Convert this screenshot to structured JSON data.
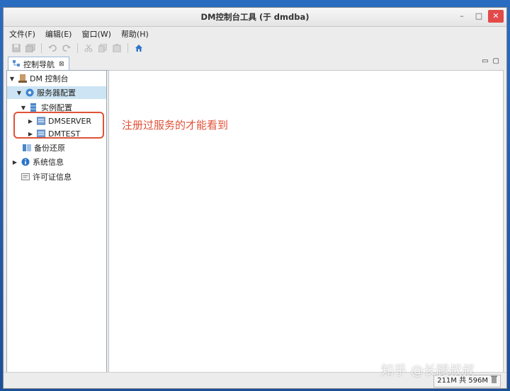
{
  "window": {
    "title": "DM控制台工具 (于 dmdba)"
  },
  "window_controls": {
    "minimize": "–",
    "maximize": "□",
    "close": "✕"
  },
  "menu": [
    "文件(F)",
    "编辑(E)",
    "窗口(W)",
    "帮助(H)"
  ],
  "tab": {
    "label": "控制导航",
    "close": "⊠"
  },
  "view_controls": {
    "minimize": "▭",
    "maximize": "▢"
  },
  "tree": {
    "root": "DM 控制台",
    "server_config": "服务器配置",
    "instance_config": "实例配置",
    "instances": [
      "DMSERVER",
      "DMTEST"
    ],
    "backup": "备份还原",
    "system_info": "系统信息",
    "license_info": "许可证信息"
  },
  "annotation": "注册过服务的才能看到",
  "status": {
    "memory": "211M 共 596M"
  },
  "watermark": "知乎 @长腿叔叔",
  "colors": {
    "annotation": "#e05238",
    "selection": "#cce4f3",
    "accent": "#2a6cc0"
  }
}
